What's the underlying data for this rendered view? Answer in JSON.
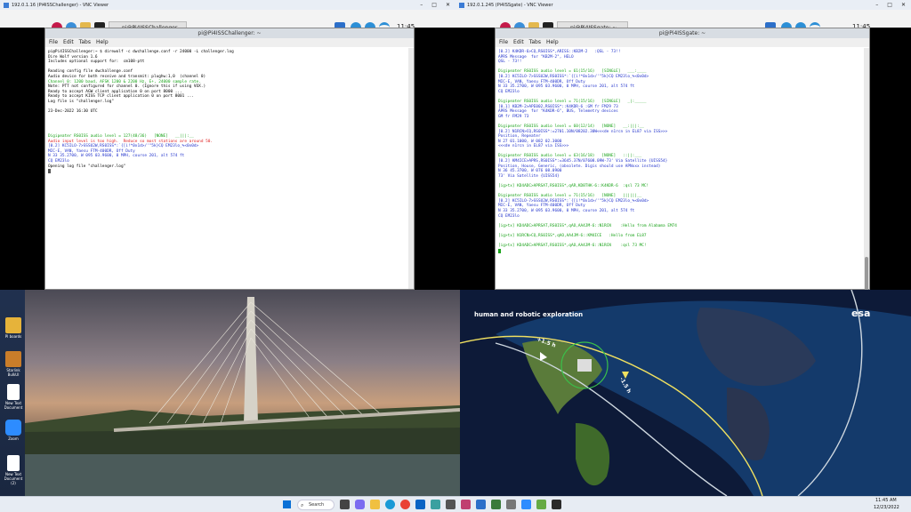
{
  "left_window": {
    "vnc_title": "192.0.1.16 (Pi4ISSChallenger) - VNC Viewer",
    "taskbar_button": "pi@Pi4ISSChallenger...",
    "clock": "11:45",
    "terminal_title": "pi@Pi4ISSChallenger: ~",
    "menu": [
      "File",
      "Edit",
      "Tabs",
      "Help"
    ],
    "lines": [
      {
        "t": "pi@Pi4ISSChallenger:~ $ direwolf -c dwchallenge.conf -r 24000 -L challenger.log",
        "c": "#000"
      },
      {
        "t": "Dire Wolf version 1.6",
        "c": "#000"
      },
      {
        "t": "Includes optional support for:  cm108-ptt",
        "c": "#000"
      },
      {
        "t": "",
        "c": "#000"
      },
      {
        "t": "Reading config file dwchallenge.conf",
        "c": "#000"
      },
      {
        "t": "Audio device for both receive and transmit: plughw:1,0  (channel 0)",
        "c": "#000"
      },
      {
        "t": "Channel 0: 1200 baud, AFSK 1200 & 2200 Hz, E+, 24000 sample rate.",
        "c": "#1aa31a"
      },
      {
        "t": "Note: PTT not configured for channel 0. (Ignore this if using VOX.)",
        "c": "#000"
      },
      {
        "t": "Ready to accept AGW client application 0 on port 8000 ...",
        "c": "#000"
      },
      {
        "t": "Ready to accept KISS TCP client application 0 on port 8001 ...",
        "c": "#000"
      },
      {
        "t": "Log file is \"challenger.log\"",
        "c": "#000"
      },
      {
        "t": "",
        "c": "#000"
      },
      {
        "t": "23-Dec-2022 16:30 UTC",
        "c": "#000"
      },
      {
        "t": "",
        "c": "#000"
      },
      {
        "t": "",
        "c": "#000"
      },
      {
        "t": "",
        "c": "#000"
      },
      {
        "t": "",
        "c": "#000"
      },
      {
        "t": "Digipeater RS0ISS audio level = 127(48/36)   [NONE]   __|||:__",
        "c": "#1aa31a"
      },
      {
        "t": "Audio input level is too high.  Reduce so most stations are around 50.",
        "c": "#e02020"
      },
      {
        "t": "[0.2] KC5ILO-7>SSSU2W,RS0ISS*:`{[i!*0x1d>/'\"5k}CQ EM23lo_%<0x0d>",
        "c": "#2233cc"
      },
      {
        "t": "MIC-E, VAN, Yaesu FTM-400DR, Off Duty",
        "c": "#2233cc"
      },
      {
        "t": "N 33 35.2700, W 095 03.9600, 0 MPH, course 201, alt 574 ft",
        "c": "#2233cc"
      },
      {
        "t": "CQ EM23lo",
        "c": "#2233cc"
      },
      {
        "t": "Opening log file \"challenger.log\"",
        "c": "#000"
      }
    ]
  },
  "right_window": {
    "vnc_title": "192.0.1.245 (Pi4ISSgate) - VNC Viewer",
    "taskbar_button": "pi@Pi4ISSgate: ~",
    "clock": "11:45",
    "terminal_title": "pi@Pi4ISSgate: ~",
    "menu": [
      "File",
      "Edit",
      "Tabs",
      "Help"
    ],
    "lines": [
      {
        "t": "[0.2] K4KDR-6>CQ,RS0ISS*,ARISS::KB2M-2   :QSL - 73!!",
        "c": "#2233cc"
      },
      {
        "t": "APRS Message  for \"KB2M-2\", HELO",
        "c": "#2233cc"
      },
      {
        "t": "QSL - 73!!",
        "c": "#2233cc"
      },
      {
        "t": "",
        "c": "#000"
      },
      {
        "t": "Digipeater RS0ISS audio level = 61(15/16)   [SINGLE]   ___:____",
        "c": "#1aa31a"
      },
      {
        "t": "[0.2] KC5ILO-7>SSSU2W,RS0ISS*:`{[i!*0x1d>/'\"5k}CQ EM23lo_%<0x0d>",
        "c": "#2233cc"
      },
      {
        "t": "MIC-E, VAN, Yaesu FTM-400DR, Off Duty",
        "c": "#2233cc"
      },
      {
        "t": "N 33 35.2700, W 095 03.9600, 0 MPH, course 201, alt 574 ft",
        "c": "#2233cc"
      },
      {
        "t": "CQ EM23lo",
        "c": "#2233cc"
      },
      {
        "t": "",
        "c": "#000"
      },
      {
        "t": "Digipeater RS0ISS audio level = 71(15/16)   [SINGLE]   _|:_____",
        "c": "#1aa31a"
      },
      {
        "t": "[0.1] KB2M-2>APE002,RS0ISS*::K4KDR-6 :GM fr FM29 73",
        "c": "#2233cc"
      },
      {
        "t": "APRS Message  for \"K4KDR-6\", BUS, Telemetry devices",
        "c": "#2233cc"
      },
      {
        "t": "GM fr FM29 73",
        "c": "#2233cc"
      },
      {
        "t": "",
        "c": "#000"
      },
      {
        "t": "Digipeater RS0ISS audio level = 60(12/14)   [NONE]   __:|||:__",
        "c": "#1aa31a"
      },
      {
        "t": "[0.2] N1RCN>CQ,RS0ISS*:=2701.10N/08202.30W<<<de n1rcn in EL87 via ISS>>>",
        "c": "#2233cc"
      },
      {
        "t": "Position, Repeater",
        "c": "#2233cc"
      },
      {
        "t": "N 27 01.1000, W 082 02.3000",
        "c": "#2233cc"
      },
      {
        "t": "<<<de n1rcn in EL87 via ISS>>>",
        "c": "#2233cc"
      },
      {
        "t": "",
        "c": "#000"
      },
      {
        "t": "Digipeater RS0ISS audio level = 63(16/18)   [NONE]   ::||:___",
        "c": "#1aa31a"
      },
      {
        "t": "[0.2] KM4ICE>APRS,RS0ISS*:=3645.37N/07608.09W-73' Via Satellite {UISS54}",
        "c": "#2233cc"
      },
      {
        "t": "Position, House, Generic, (obsolete. Digis should use APNxxx instead)",
        "c": "#2233cc"
      },
      {
        "t": "N 36 45.3700, W 076 08.0900",
        "c": "#2233cc"
      },
      {
        "t": "73' Via Satellite {UISS54}",
        "c": "#2233cc"
      },
      {
        "t": "",
        "c": "#000"
      },
      {
        "t": "[ig>tx] KD4ADC>APRSAT,RS0ISS*,qAR,KD8THK-6::K4KDR-6  :qsl 73 MC!",
        "c": "#1aa31a"
      },
      {
        "t": "",
        "c": "#000"
      },
      {
        "t": "Digipeater RS0ISS audio level = 71(15/16)   [NONE]   ||||||__",
        "c": "#1aa31a"
      },
      {
        "t": "[0.2] KC5ILO-7>SSSU2W,RS0ISS*:`{[i!*0x1d>/'\"5k}CQ EM23lo_%<0x0d>",
        "c": "#2233cc"
      },
      {
        "t": "MIC-E, VAN, Yaesu FTM-400DR, Off Duty",
        "c": "#2233cc"
      },
      {
        "t": "N 33 35.2700, W 095 03.9600, 0 MPH, course 201, alt 574 ft",
        "c": "#2233cc"
      },
      {
        "t": "CQ EM23lo",
        "c": "#2233cc"
      },
      {
        "t": "",
        "c": "#000"
      },
      {
        "t": "[ig>tx] KD4ADC>APRSAT,RS0ISS*,qAO,AA4JM-6::N1RCN    :Hello from Alabama EM74",
        "c": "#1aa31a"
      },
      {
        "t": "",
        "c": "#000"
      },
      {
        "t": "[ig>tx] N1RCN>CQ,RS0ISS*,qAO,AA4JM-6::KM4ICE   :Hello from EL87",
        "c": "#1aa31a"
      },
      {
        "t": "",
        "c": "#000"
      },
      {
        "t": "[ig>tx] KD4ADC>APRSAT,RS0ISS*,qAO,AA4JM-6::N1RCN    :qsl 73 MC!",
        "c": "#1aa31a"
      }
    ]
  },
  "esa": {
    "heading": "human and robotic exploration",
    "logo": "esa",
    "marker_plus": "+1.5 h",
    "marker_minus": "-1.5 h"
  },
  "desktop_icons": [
    {
      "label": "",
      "color": "#2b6fd6"
    },
    {
      "label": "",
      "color": "#1e9be0"
    },
    {
      "label": "",
      "color": "#f5a623"
    },
    {
      "label": "",
      "color": "#d0d5de"
    },
    {
      "label": "PI boards",
      "color": "#e6b33a"
    },
    {
      "label": "Starlink BulkUI",
      "color": "#c97d2a"
    },
    {
      "label": "New Text Document",
      "color": "#ffffff"
    },
    {
      "label": "Zoom",
      "color": "#2d8cff"
    },
    {
      "label": "New Text Document (2)",
      "color": "#ffffff"
    }
  ],
  "taskbar": {
    "search_label": "Search",
    "time": "11:45 AM",
    "date": "12/23/2022"
  }
}
